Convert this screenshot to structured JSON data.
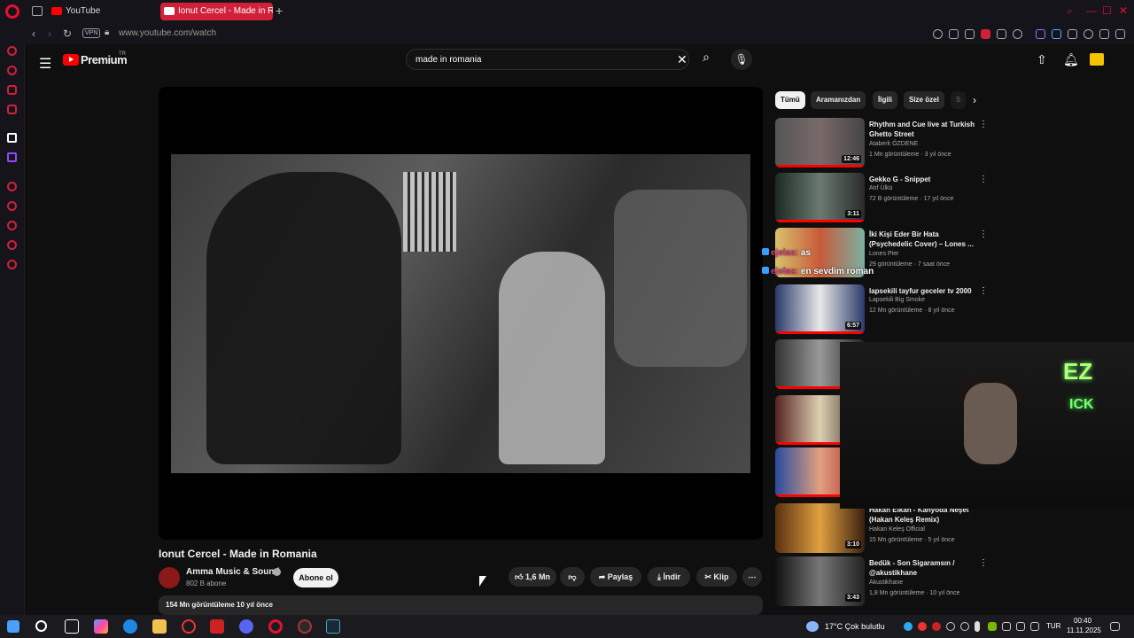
{
  "browser": {
    "tabs": [
      {
        "label": "YouTube"
      },
      {
        "label": "Ionut Cercel - Made in Romania"
      }
    ],
    "new_tab": "+",
    "url": "www.youtube.com/watch",
    "vpn": "VPN"
  },
  "header": {
    "brand": "Premium",
    "brand_sup": "TR",
    "search_value": "made in romania"
  },
  "video": {
    "title": "Ionut Cercel - Made in Romania",
    "channel": "Amma Music & Sound",
    "subscribers": "802 B abone",
    "subscribe_label": "Abone ol",
    "likes": "1,6 Mn",
    "share": "Paylaş",
    "download": "İndir",
    "clip": "Klip",
    "views_date": "154 Mn görüntüleme  10 yıl önce"
  },
  "chips": [
    "Tümü",
    "Aramanızdan",
    "İlgili",
    "Size özel",
    "S"
  ],
  "recommendations": [
    {
      "title": "Rhythm and Cue live at Turkish Ghetto Street",
      "channel": "Ataberk ÖZDENE",
      "meta": "1 Mn görüntüleme · 3 yıl önce",
      "duration": "12:46"
    },
    {
      "title": "Gekko G - Snippet",
      "channel": "Atıf Ülkü",
      "meta": "72 B görüntüleme · 17 yıl önce",
      "duration": "3:11"
    },
    {
      "title": "İki Kişi Eder Bir Hata (Psychedelic Cover) – Lones ...",
      "channel": "Lones Pier",
      "meta": "29 görüntüleme · 7 saat önce",
      "duration": ""
    },
    {
      "title": "lapsekili tayfur geceler tv 2000",
      "channel": "Lapsekili Big Smoke",
      "meta": "12 Mn görüntüleme · 8 yıl önce",
      "duration": "6:57"
    },
    {
      "title": "Hakan Elkan - Kanyoda Neşet (Hakan Keleş Remix)",
      "channel": "Hakan Keleş Official",
      "meta": "15 Mn görüntüleme · 5 yıl önce",
      "duration": "3:10"
    },
    {
      "title": "Bedük - Son Sigaramsın / @akustikhane",
      "channel": "Akustikhane",
      "meta": "1,8 Mn görüntüleme · 10 yıl önce",
      "duration": "3:43"
    }
  ],
  "overlay_chat": [
    {
      "user": "ejelas:",
      "message": "as"
    },
    {
      "user": "ejelas:",
      "message": "en sevdim roman"
    }
  ],
  "cam": {
    "neon_top": "EZ",
    "neon_bottom": "ICK"
  },
  "taskbar": {
    "weather": "17°C  Çok bulutlu",
    "lang": "TUR",
    "time": "00:40",
    "date": "11.11.2025"
  }
}
